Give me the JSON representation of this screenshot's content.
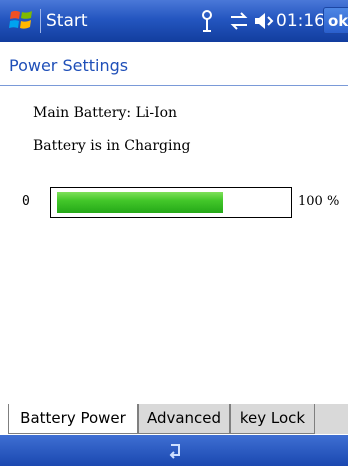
{
  "titlebar": {
    "start_label": "Start",
    "clock": "01:16",
    "ok_label": "ok",
    "icons": [
      "windows-logo-icon",
      "signal-icon",
      "sync-icon",
      "speaker-icon"
    ]
  },
  "header": {
    "title": "Power Settings"
  },
  "content": {
    "main_battery": "Main Battery: Li-Ion",
    "charging_status": "Battery is in Charging",
    "progress": {
      "min_label": "0",
      "max_label": "100 %",
      "level_percent": 73
    }
  },
  "tabs": [
    {
      "label": "Battery Power",
      "active": true
    },
    {
      "label": "Advanced",
      "active": false
    },
    {
      "label": "key Lock",
      "active": false
    }
  ],
  "bottombar": {
    "icon": "sip-keyboard-icon"
  },
  "colors": {
    "titlebar_blue": "#2456c0",
    "title_text": "#1f4fb8",
    "progress_green": "#43c72a",
    "tab_inactive": "#d9d9d9"
  }
}
